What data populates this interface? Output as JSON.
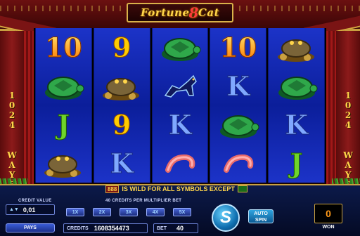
{
  "game": {
    "logo_pre": "Fortune",
    "logo_eight": "8",
    "logo_post": "Cat",
    "ways_number": "1024",
    "ways_word": "WAYS"
  },
  "reels": [
    [
      "10",
      "turtle",
      "J",
      "toad"
    ],
    [
      "9",
      "toad",
      "9",
      "K"
    ],
    [
      "turtle",
      "cat",
      "K",
      "fish"
    ],
    [
      "10",
      "K",
      "turtle",
      "fish"
    ],
    [
      "toad",
      "turtle",
      "K",
      "J"
    ]
  ],
  "banner": {
    "badge": "888",
    "text": "IS WILD FOR ALL SYMBOLS EXCEPT"
  },
  "controls": {
    "credit_value_label": "CREDIT VALUE",
    "credit_value": "0,01",
    "pays_label": "PAYS",
    "multiplier_label": "40 CREDITS PER MULTIPLIER BET",
    "multipliers": [
      "1X",
      "2X",
      "3X",
      "4X",
      "5X"
    ],
    "credits_label": "CREDITS",
    "credits_value": "1608354473",
    "bet_label": "BET",
    "bet_value": "40",
    "spin_label": "S",
    "auto_line1": "AUTO",
    "auto_line2": "SPIN",
    "won_value": "0",
    "won_label": "WON"
  },
  "colors": {
    "reel_blue": "#1c33c8",
    "gold": "#ffd54a",
    "red": "#7a1414"
  }
}
